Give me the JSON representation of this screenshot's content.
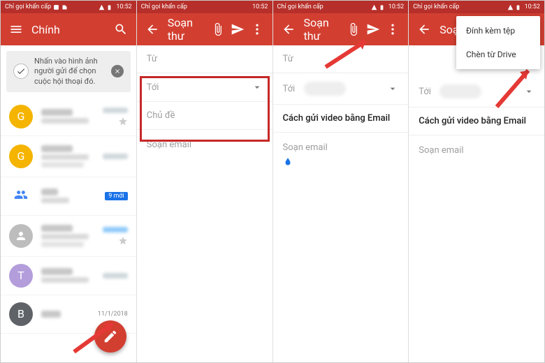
{
  "status": {
    "emergency_label": "Chỉ gọi khẩn cấp",
    "time": "10:52"
  },
  "panel1": {
    "title": "Chính",
    "tip_text": "Nhấn vào hình ảnh người gửi để chọn cuộc hội thoại đó.",
    "badge_new": "9 mới",
    "date_hint": "11/1/2018"
  },
  "compose": {
    "title": "Soạn thư",
    "from_label": "Từ",
    "to_label": "Tới",
    "subject_placeholder": "Chủ đề",
    "body_placeholder": "Soạn email",
    "subject_filled": "Cách gửi video bằng Email"
  },
  "menu": {
    "attach_file": "Đính kèm tệp",
    "insert_drive": "Chèn từ Drive"
  },
  "colors": {
    "primary": "#d23f31",
    "primary_dark": "#b62f2a",
    "accent_red": "#e53935",
    "link_blue": "#1a73e8"
  }
}
